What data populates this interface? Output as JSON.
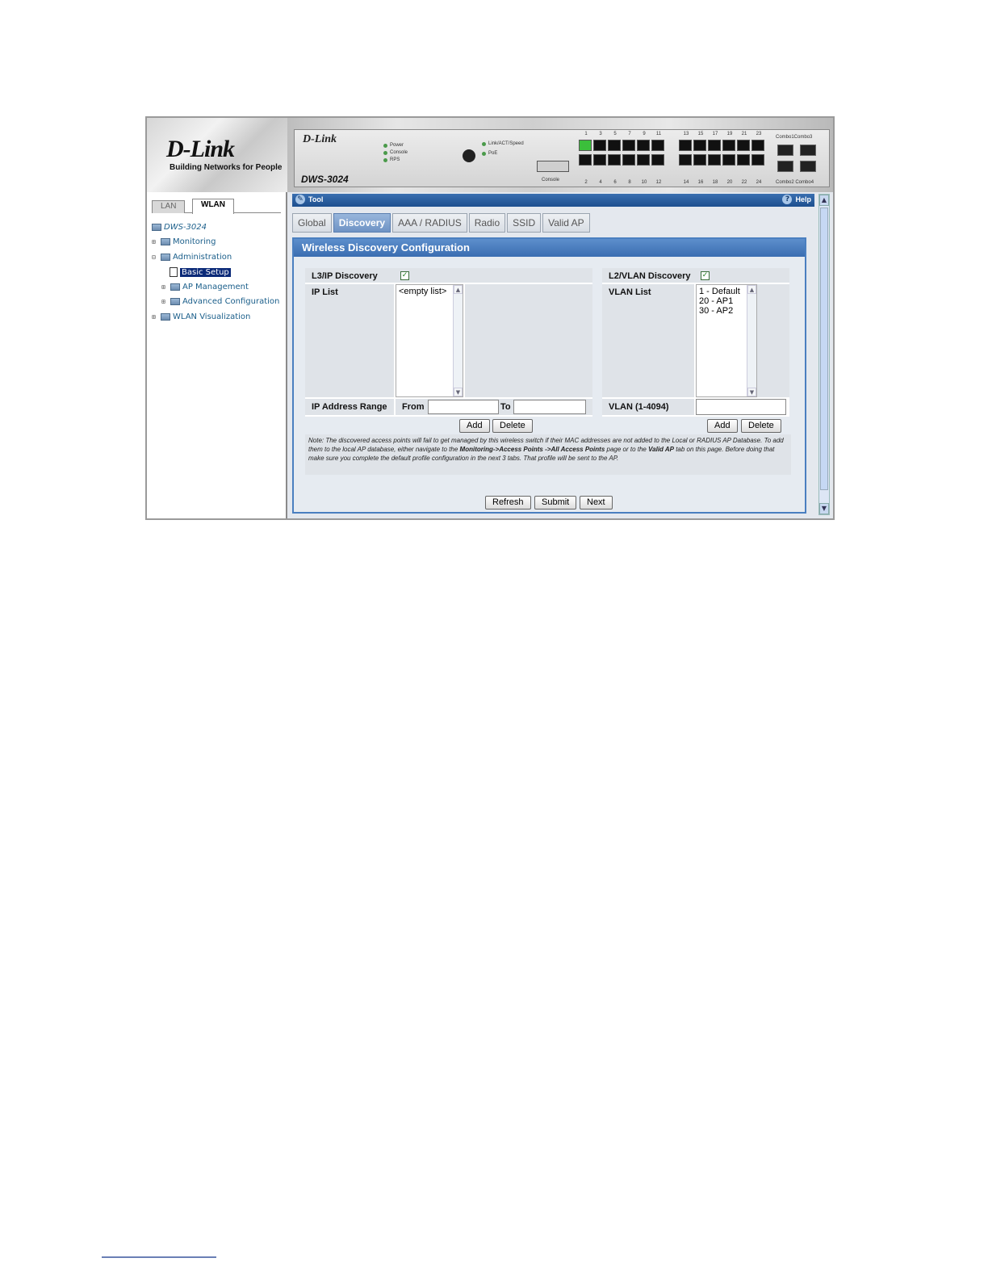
{
  "header": {
    "logo": "D-Link",
    "tagline": "Building Networks for People",
    "device": {
      "brand": "D-Link",
      "model": "DWS-3024",
      "leds": [
        "Power",
        "Console",
        "RPS"
      ],
      "leds2": [
        "Link/ACT/Speed",
        "PoE"
      ],
      "console_label": "Console",
      "top_ports_a": [
        "1",
        "3",
        "5",
        "7",
        "9",
        "11"
      ],
      "top_ports_b": [
        "13",
        "15",
        "17",
        "19",
        "21",
        "23"
      ],
      "bottom_ports_a": [
        "2",
        "4",
        "6",
        "8",
        "10",
        "12"
      ],
      "bottom_ports_b": [
        "14",
        "16",
        "18",
        "20",
        "22",
        "24"
      ],
      "combo_top": "Combo1Combo3",
      "combo_bottom": "Combo2 Combo4"
    }
  },
  "sidebar": {
    "tabs": [
      "LAN",
      "WLAN"
    ],
    "tree": {
      "root": "DWS-3024",
      "monitoring": "Monitoring",
      "administration": "Administration",
      "basic_setup": "Basic Setup",
      "ap_management": "AP Management",
      "advanced_configuration": "Advanced Configuration",
      "wlan_visualization": "WLAN Visualization"
    }
  },
  "toolbar": {
    "tool": "Tool",
    "help": "Help"
  },
  "tabs": [
    "Global",
    "Discovery",
    "AAA / RADIUS",
    "Radio",
    "SSID",
    "Valid AP"
  ],
  "active_tab": "Discovery",
  "section_title": "Wireless Discovery Configuration",
  "l3": {
    "discovery_label": "L3/IP Discovery",
    "discovery_checked": true,
    "list_label": "IP List",
    "list_items": [
      "<empty list>"
    ],
    "range_label": "IP Address Range",
    "from_label": "From",
    "to_label": "To",
    "from_value": "",
    "to_value": "",
    "add": "Add",
    "delete": "Delete"
  },
  "l2": {
    "discovery_label": "L2/VLAN Discovery",
    "discovery_checked": true,
    "list_label": "VLAN List",
    "list_items": [
      "1 - Default",
      "20 - AP1",
      "30 - AP2"
    ],
    "vlan_label": "VLAN (1-4094)",
    "vlan_value": "",
    "add": "Add",
    "delete": "Delete"
  },
  "note": {
    "part1": "Note: The discovered access points will fail to get managed by this wireless switch if their MAC addresses are not added to the Local or RADIUS AP Database. To add them to the local AP database, either navigate to the ",
    "bold1": "Monitoring->Access Points ->All Access Points",
    "part2": " page or to the ",
    "bold2": "Valid AP",
    "part3": " tab on this page. Before doing that make sure you complete the default profile configuration in the next 3 tabs. That profile will be sent to the AP."
  },
  "buttons": {
    "refresh": "Refresh",
    "submit": "Submit",
    "next": "Next"
  },
  "colors": {
    "header_blue": "#3a6db1",
    "active_tab": "#6e93c4",
    "selection": "#0b2a78"
  }
}
